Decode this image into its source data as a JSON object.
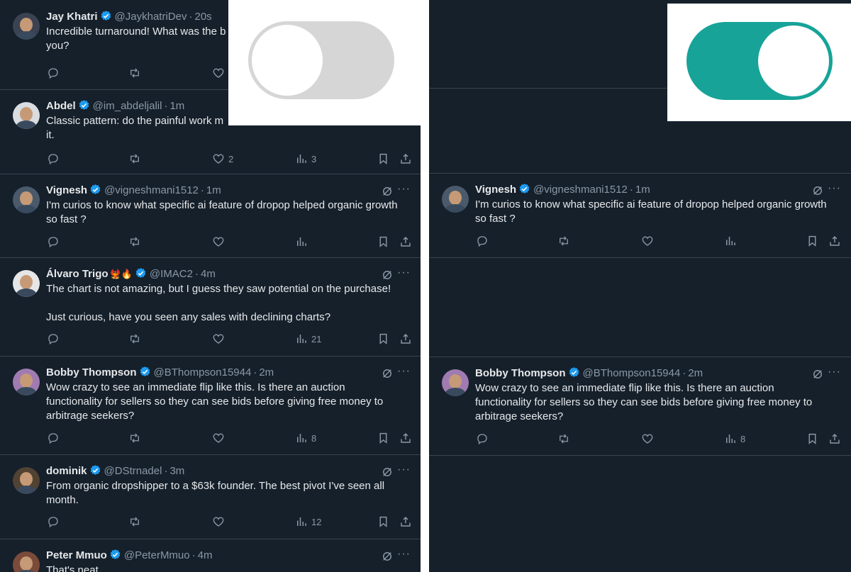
{
  "colors": {
    "background": "#15202b",
    "text": "#e7e9ea",
    "muted": "#8b98a5",
    "verified": "#1d9bf0",
    "border": "#38444d",
    "toggle_off": "#d6d6d6",
    "toggle_on": "#17a398"
  },
  "icons": [
    "reply-icon",
    "retweet-icon",
    "like-icon",
    "views-icon",
    "bookmark-icon",
    "share-icon",
    "verified-icon",
    "grok-icon",
    "more-icon"
  ],
  "left_toggle": {
    "state": "off"
  },
  "right_toggle": {
    "state": "on"
  },
  "left_tweets": [
    {
      "name": "Jay Khatri",
      "handle": "@JaykhatriDev",
      "time": "20s",
      "text": "Incredible turnaround! What was the b\nyou?",
      "likes": "",
      "views": ""
    },
    {
      "name": "Abdel",
      "handle": "@im_abdeljalil",
      "time": "1m",
      "text": "Classic pattern: do the painful work m\nit.",
      "likes": "2",
      "views": "3"
    },
    {
      "name": "Vignesh",
      "handle": "@vigneshmani1512",
      "time": "1m",
      "text": "I'm curios to know what specific ai feature of dropop helped organic growth\nso fast ?",
      "likes": "",
      "views": ""
    },
    {
      "name": "Álvaro Trigo",
      "emoji": "🐦‍🔥🔥",
      "handle": "@IMAC2",
      "time": "4m",
      "text": "The chart is not amazing, but I guess they saw potential on the purchase!\n\nJust curious, have you seen any sales with declining charts?",
      "likes": "",
      "views": "21"
    },
    {
      "name": "Bobby Thompson",
      "handle": "@BThompson15944",
      "time": "2m",
      "text": "Wow crazy to see an immediate flip like this. Is there an auction\nfunctionality for sellers so they can see bids before giving free money to\narbitrage seekers?",
      "likes": "",
      "views": "8"
    },
    {
      "name": "dominik",
      "handle": "@DStrnadel",
      "time": "3m",
      "text": "From organic dropshipper to a $63k founder. The best pivot I've seen all\nmonth.",
      "likes": "",
      "views": "12"
    },
    {
      "name": "Peter Mmuo",
      "handle": "@PeterMmuo",
      "time": "4m",
      "text": "That's neat",
      "likes": "",
      "views": ""
    }
  ],
  "right_tweets": [
    {
      "name": "Vignesh",
      "handle": "@vigneshmani1512",
      "time": "1m",
      "text": "I'm curios to know what specific ai feature of dropop helped organic growth\nso fast ?",
      "likes": "",
      "views": ""
    },
    {
      "name": "Bobby Thompson",
      "handle": "@BThompson15944",
      "time": "2m",
      "text": "Wow crazy to see an immediate flip like this. Is there an auction\nfunctionality for sellers so they can see bids before giving free money to\narbitrage seekers?",
      "likes": "",
      "views": "8"
    }
  ]
}
